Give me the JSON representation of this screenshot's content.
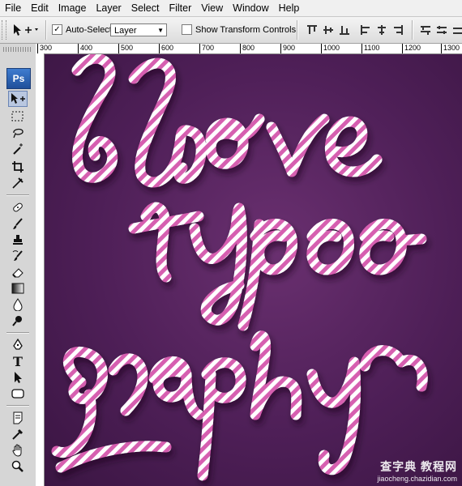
{
  "menu": [
    "File",
    "Edit",
    "Image",
    "Layer",
    "Select",
    "Filter",
    "View",
    "Window",
    "Help"
  ],
  "options_bar": {
    "auto_select_label": "Auto-Select:",
    "auto_select_value": "Layer",
    "transform_label": "Show Transform Controls"
  },
  "toolbox": {
    "logo": "Ps"
  },
  "ruler": {
    "ticks": [
      "300",
      "400",
      "500",
      "600",
      "700",
      "800",
      "900",
      "1000",
      "1100",
      "1200",
      "1300"
    ]
  },
  "watermark": {
    "line1": "查字典 教程网",
    "line2": "jiaocheng.chazidian.com"
  },
  "colors": {
    "canvas_bg": "#4e1f57",
    "candy_pink": "#d65fb0",
    "candy_white": "#ffffff"
  }
}
